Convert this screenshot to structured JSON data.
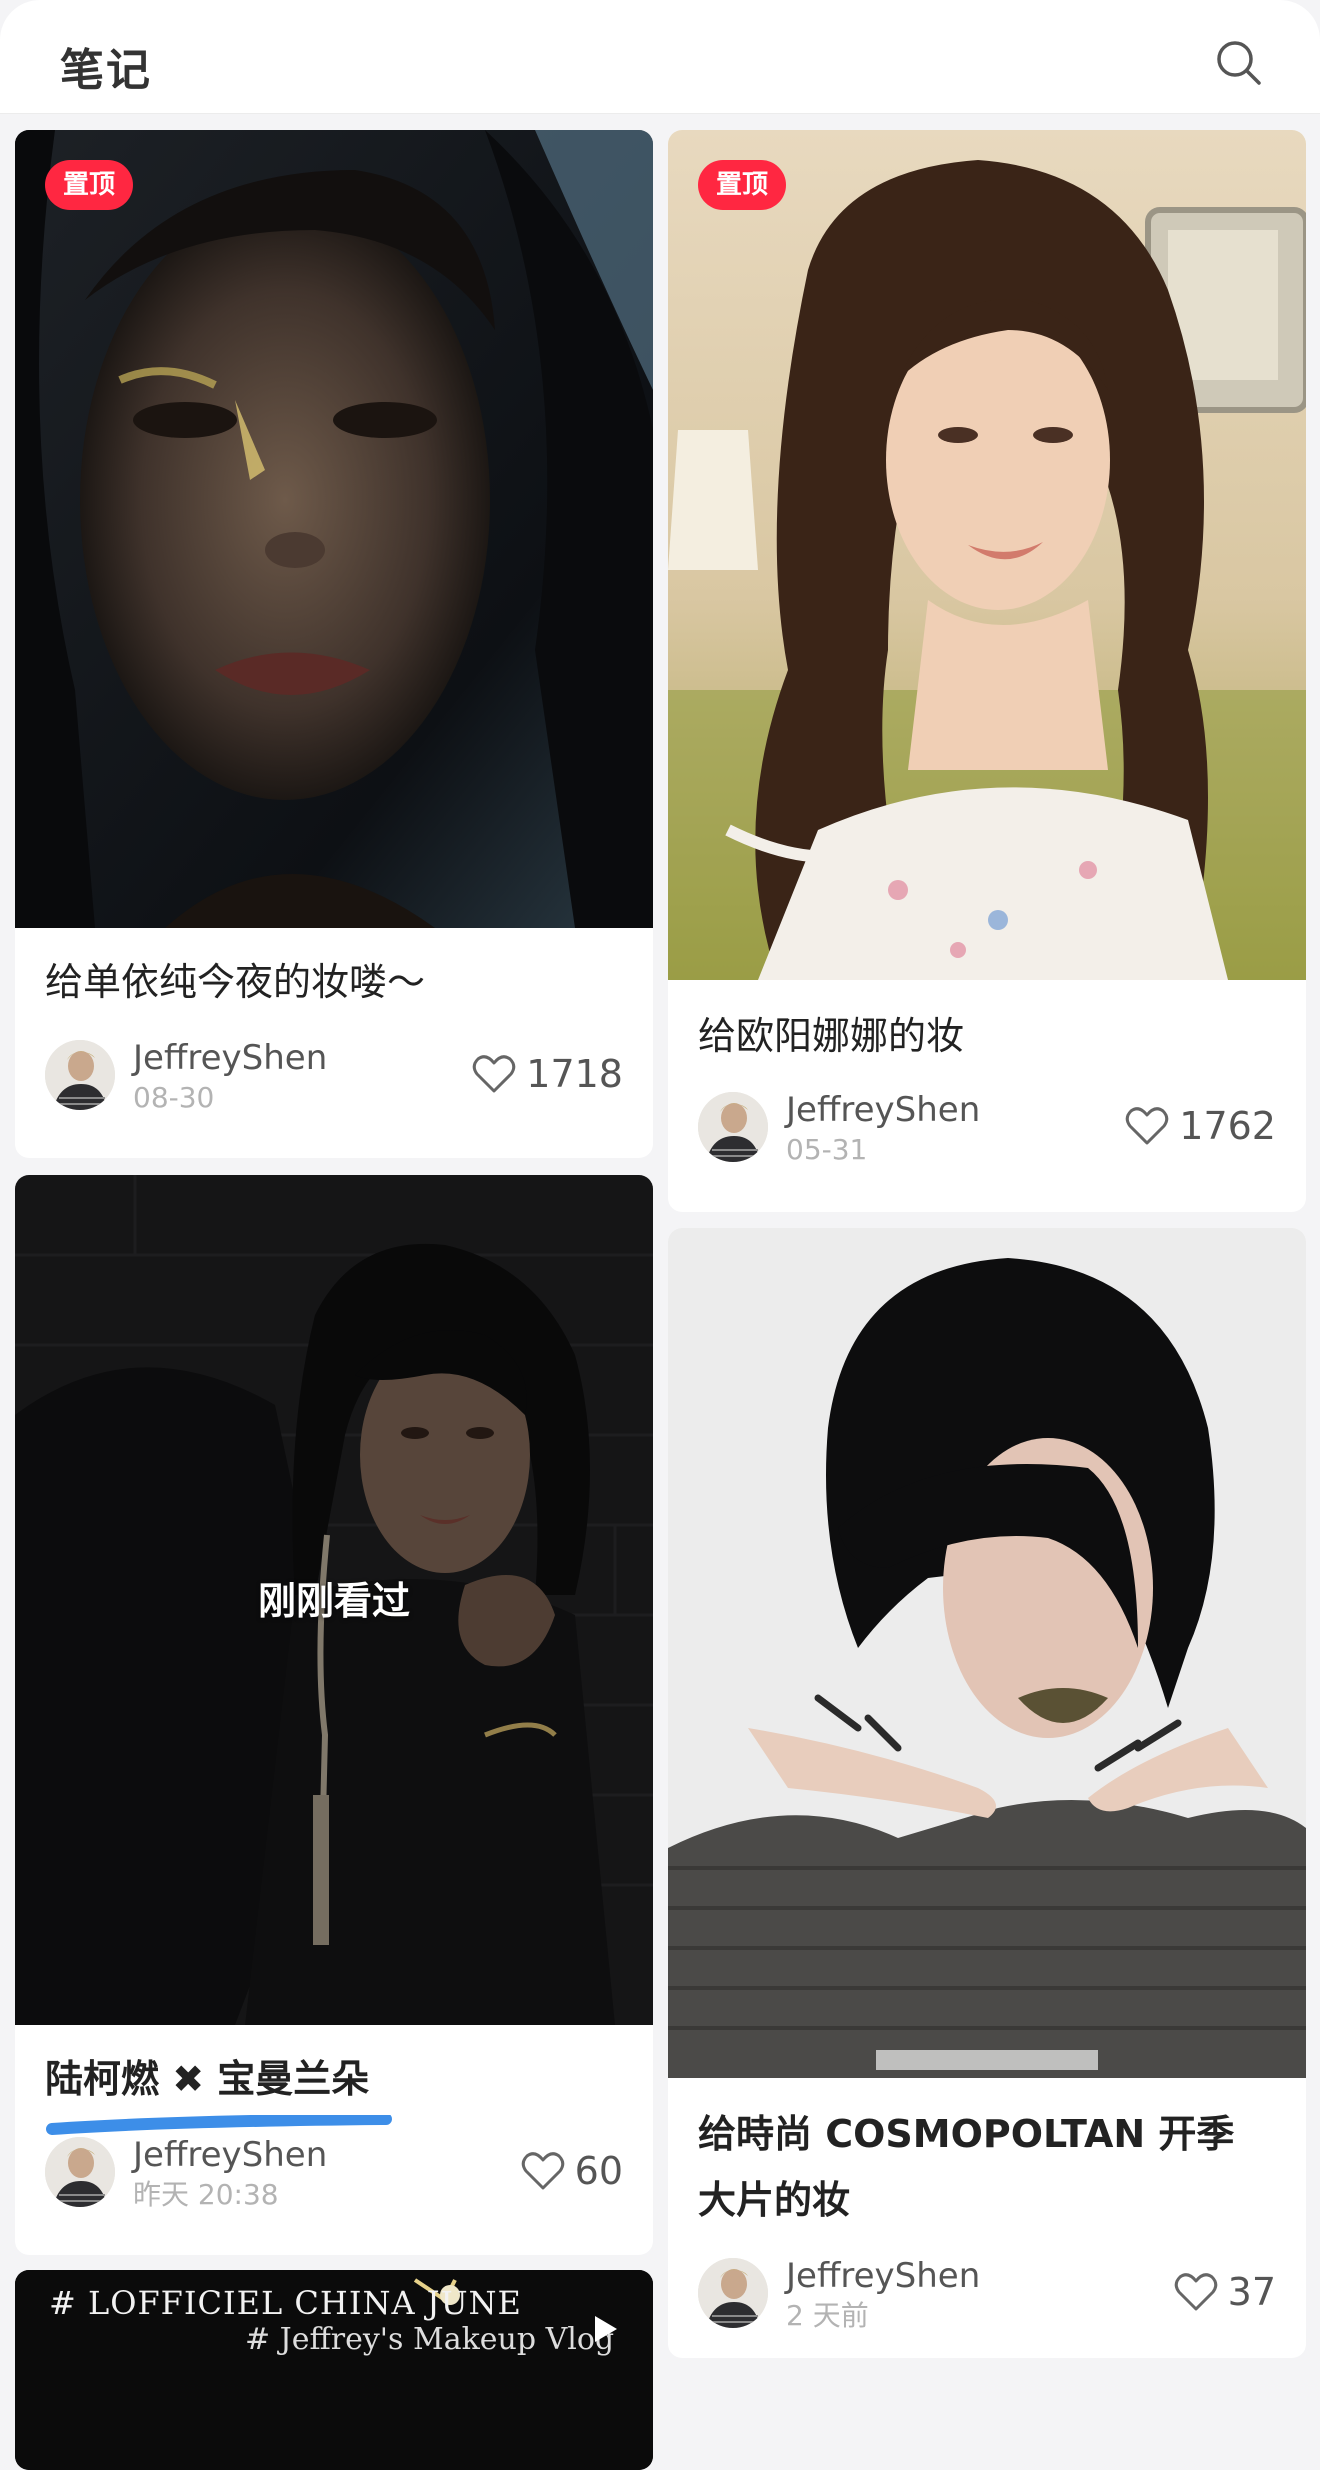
{
  "header": {
    "title": "笔记",
    "search_icon": "search-icon"
  },
  "notes": [
    {
      "pin_label": "置顶",
      "title": "给单依纯今夜的妆喽～",
      "author": "JeffreyShen",
      "date": "08-30",
      "likes": "1718"
    },
    {
      "pin_label": "置顶",
      "title": "给欧阳娜娜的妆",
      "author": "JeffreyShen",
      "date": "05-31",
      "likes": "1762"
    },
    {
      "overlay_label": "刚刚看过",
      "title": "陆柯燃 ✖ 宝曼兰朵",
      "author": "JeffreyShen",
      "date": "昨天 20:38",
      "likes": "60"
    },
    {
      "title_line1": "给時尚 COSMOPOLTAN 开季",
      "title_line2": "大片的妆",
      "author": "JeffreyShen",
      "date": "2 天前",
      "likes": "37"
    },
    {
      "cover_text_line1": "# LOFFICIEL CHINA JUNE",
      "cover_text_line2": "# Jeffrey's Makeup Vlog"
    }
  ],
  "colors": {
    "pin_red": "#ff2741",
    "underline_blue": "#3d8ee8",
    "background": "#f4f4f6"
  }
}
